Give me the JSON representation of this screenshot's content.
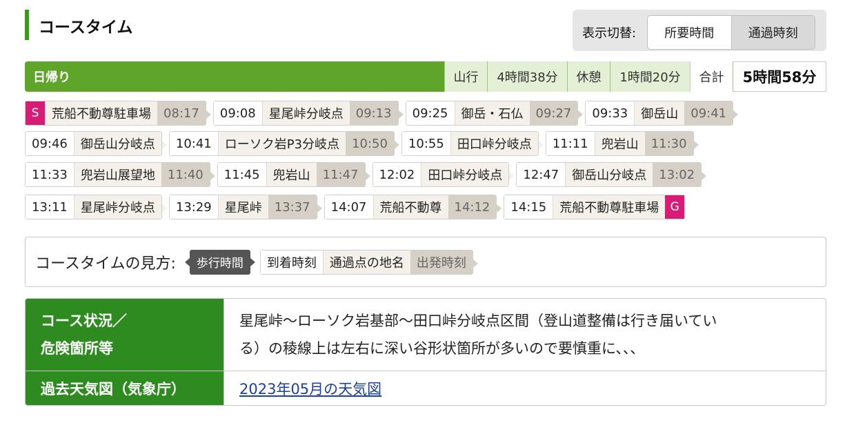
{
  "header": {
    "title": "コースタイム",
    "toggle_label": "表示切替:",
    "toggle_options": [
      "所要時間",
      "通過時刻"
    ]
  },
  "summary": {
    "day": "日帰り",
    "walk_label": "山行",
    "walk_time": "4時間38分",
    "rest_label": "休憩",
    "rest_time": "1時間20分",
    "total_label": "合計",
    "total_time": "5時間58分"
  },
  "route": {
    "start_badge": "S",
    "goal_badge": "G",
    "stops": [
      {
        "arr": "",
        "name": "荒船不動尊駐車場",
        "dep": "08:17"
      },
      {
        "arr": "09:08",
        "name": "星尾峠分岐点",
        "dep": "09:13"
      },
      {
        "arr": "09:25",
        "name": "御岳・石仏",
        "dep": "09:27"
      },
      {
        "arr": "09:33",
        "name": "御岳山",
        "dep": "09:41"
      },
      {
        "arr": "09:46",
        "name": "御岳山分岐点",
        "dep": ""
      },
      {
        "arr": "10:41",
        "name": "ローソク岩P3分岐点",
        "dep": "10:50"
      },
      {
        "arr": "10:55",
        "name": "田口峠分岐点",
        "dep": ""
      },
      {
        "arr": "11:11",
        "name": "兜岩山",
        "dep": "11:30"
      },
      {
        "arr": "11:33",
        "name": "兜岩山展望地",
        "dep": "11:40"
      },
      {
        "arr": "11:45",
        "name": "兜岩山",
        "dep": "11:47"
      },
      {
        "arr": "12:02",
        "name": "田口峠分岐点",
        "dep": ""
      },
      {
        "arr": "12:47",
        "name": "御岳山分岐点",
        "dep": "13:02"
      },
      {
        "arr": "13:11",
        "name": "星尾峠分岐点",
        "dep": ""
      },
      {
        "arr": "13:29",
        "name": "星尾峠",
        "dep": "13:37"
      },
      {
        "arr": "14:07",
        "name": "荒船不動尊",
        "dep": "14:12"
      },
      {
        "arr": "14:15",
        "name": "荒船不動尊駐車場",
        "dep": ""
      }
    ]
  },
  "legend": {
    "label": "コースタイムの見方:",
    "walk": "歩行時間",
    "arr": "到着時刻",
    "name": "通過点の地名",
    "dep": "出発時刻"
  },
  "info": {
    "status_head_1": "コース状況／",
    "status_head_2": "危険箇所等",
    "status_text_1": "星尾峠～ローソク岩基部～田口峠分岐点区間（登山道整備は行き届いてい",
    "status_text_2": "る）の稜線上は左右に深い谷形状箇所が多いので要慎重に、、、",
    "weather_head": "過去天気図（気象庁）",
    "weather_link": "2023年05月の天気図"
  }
}
